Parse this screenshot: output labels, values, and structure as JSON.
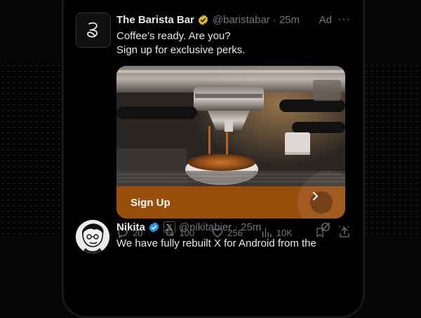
{
  "ad_post": {
    "name": "The Barista Bar",
    "handle": "@baristabar",
    "separator": "·",
    "time": "25m",
    "ad_label": "Ad",
    "more": "···",
    "text_line1": "Coffee’s ready. Are you?",
    "text_line2": "Sign up for exclusive perks.",
    "cta_label": "Sign Up",
    "counts": {
      "replies": "20",
      "reposts": "100",
      "likes": "256",
      "views": "10K"
    },
    "brand_color": "#9a4e0c"
  },
  "next_post": {
    "name": "Nikita",
    "handle": "@nikitabier",
    "separator": "·",
    "time": "25m",
    "more": "···",
    "text": "We have fully rebuilt X for Android from the"
  },
  "colors": {
    "verified_gold": "#e2b719",
    "verified_blue": "#1d9bf0",
    "muted": "#71767b"
  }
}
